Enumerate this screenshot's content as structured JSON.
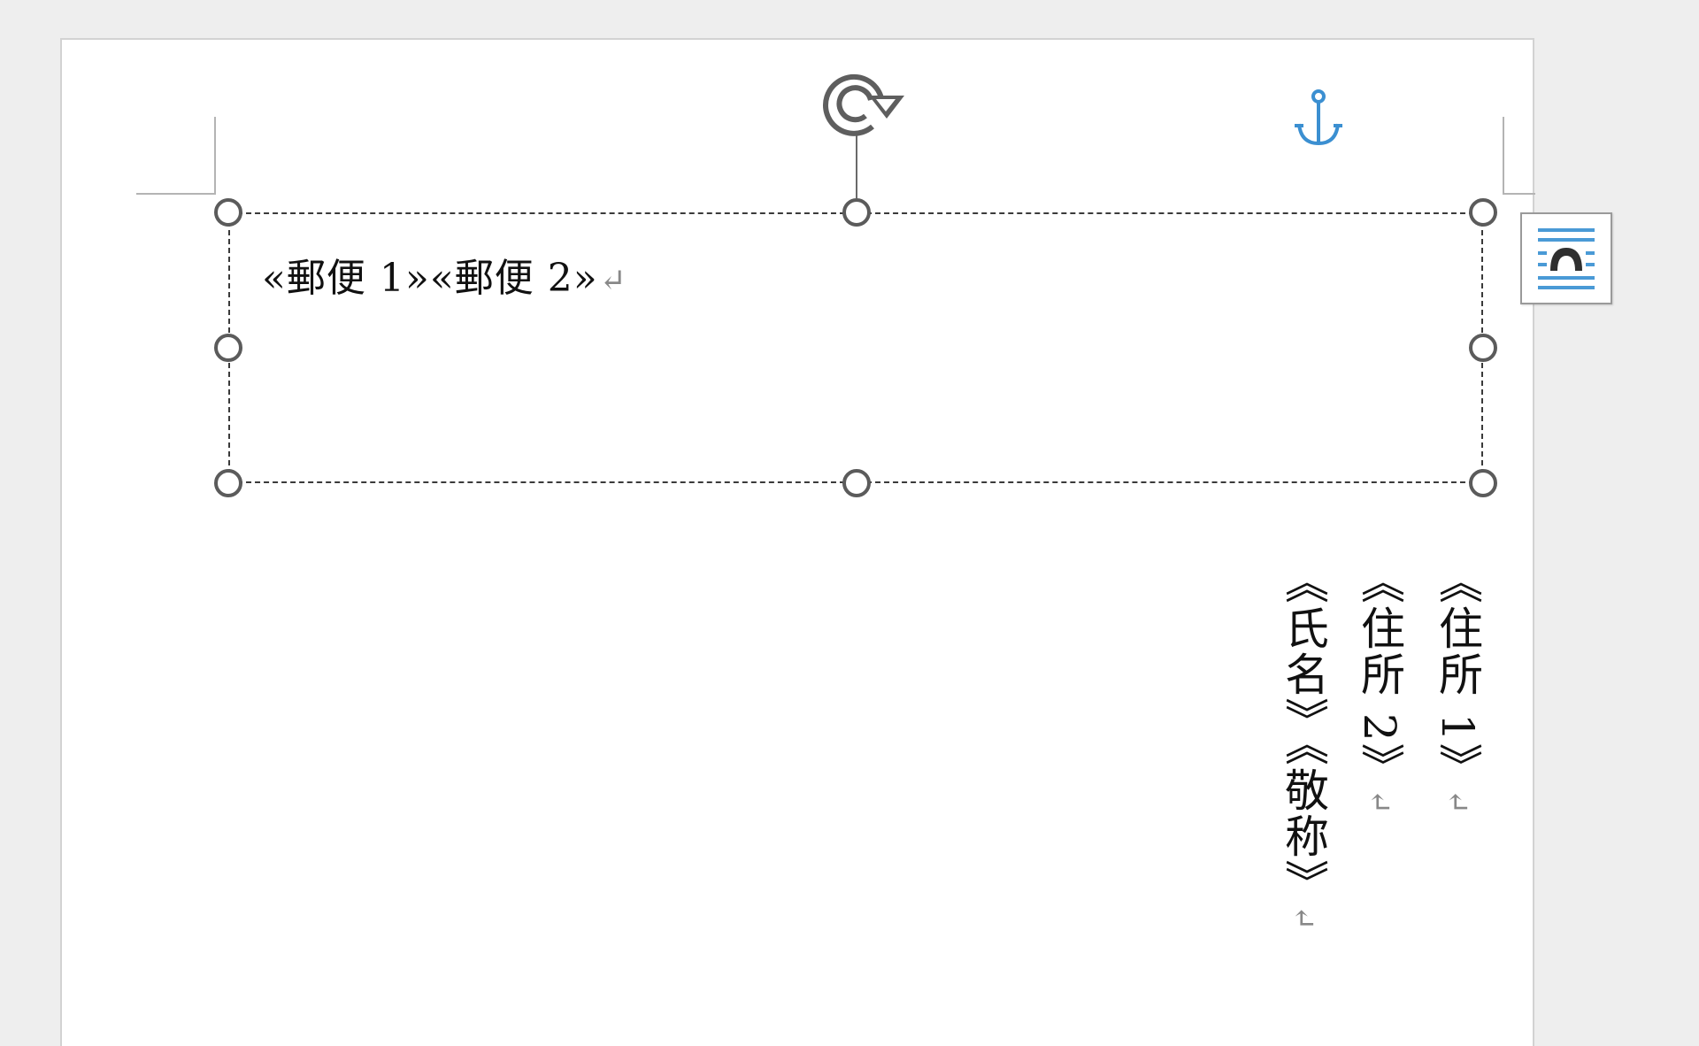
{
  "textbox": {
    "line": "«郵便 1»«郵便 2»",
    "paragraph_mark": "↵"
  },
  "address_columns": [
    {
      "text": "《住所 1》",
      "mark": "↵"
    },
    {
      "text": "《住所 2》",
      "mark": "↵"
    },
    {
      "text": "《氏名》《敬称》",
      "mark": "↵"
    }
  ],
  "icons": {
    "rotate": "rotate-handle-icon",
    "anchor": "anchor-icon",
    "layout_options": "layout-options-icon"
  },
  "colors": {
    "anchor": "#3b8fd1",
    "layout_lines": "#4a9ad6",
    "handle_stroke": "#5b5b5b"
  }
}
